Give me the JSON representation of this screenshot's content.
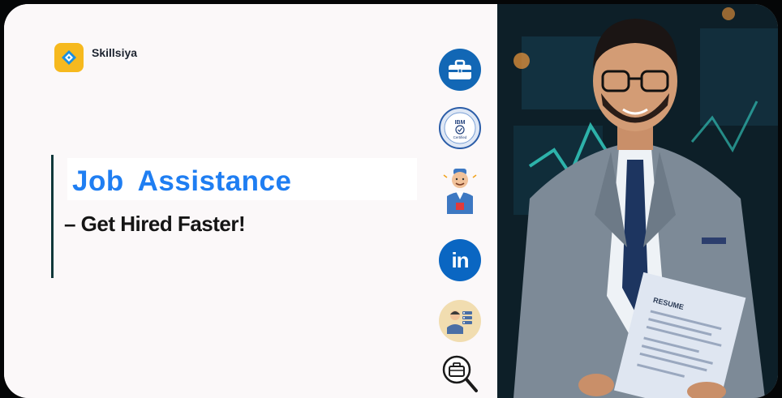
{
  "brand": {
    "name": "Skillsiya",
    "logo_color": "#f6b91e"
  },
  "hero": {
    "headline": "Job Assistance",
    "subheadline": "– Get Hired Faster!",
    "headline_color": "#1f7ef2",
    "accent_bar_color": "#10383a"
  },
  "icons": [
    {
      "name": "briefcase-icon",
      "color": "#1267b5"
    },
    {
      "name": "ibm-certified-badge-icon",
      "label": "IBM",
      "sublabel": "Certified",
      "color": "#2b5da8"
    },
    {
      "name": "interviewer-icon",
      "color": "#3d78c2"
    },
    {
      "name": "linkedin-icon",
      "label": "in",
      "color": "#0a66c2"
    },
    {
      "name": "recruiter-icon",
      "color": "#f1ddb0"
    },
    {
      "name": "job-search-icon",
      "color": "#1a1a1a"
    }
  ],
  "photo": {
    "subject": "professional-man-in-suit-holding-resume",
    "document_heading": "RESUME"
  }
}
